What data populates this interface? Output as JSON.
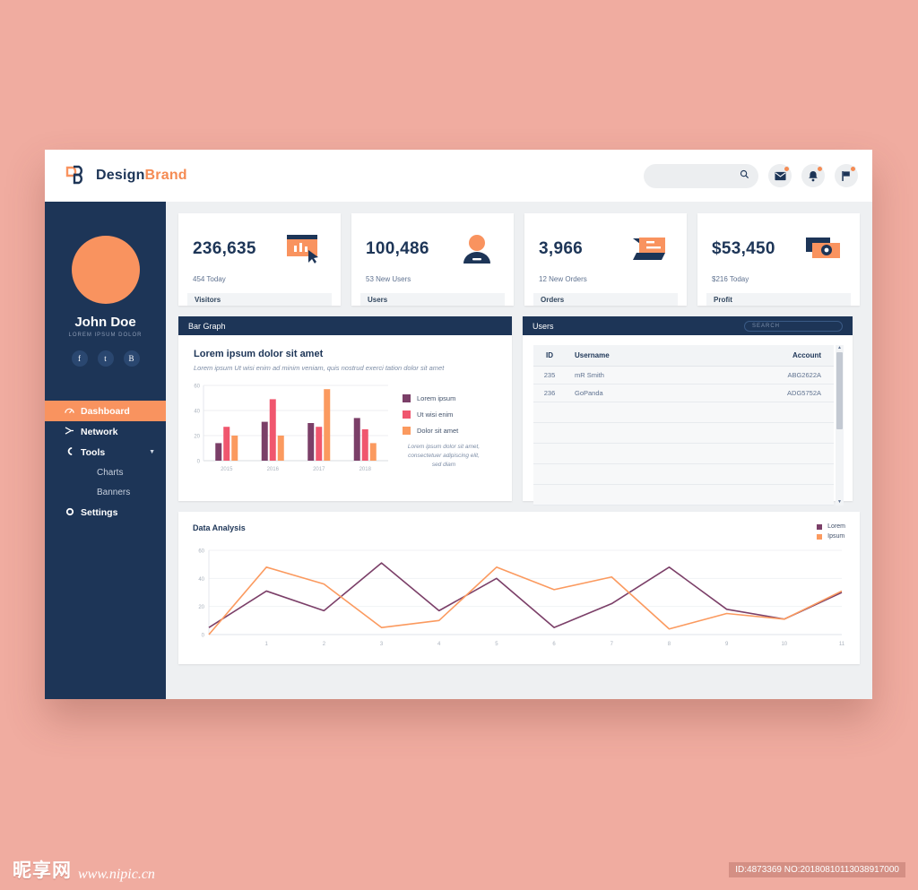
{
  "header": {
    "brand_first": "Design",
    "brand_second": "Brand",
    "search_placeholder": "",
    "search_value": "",
    "icons": [
      "search-icon",
      "mail-icon",
      "bell-icon",
      "flag-icon"
    ]
  },
  "sidebar": {
    "profile": {
      "name": "John Doe",
      "subtitle": "LOREM IPSUM DOLOR"
    },
    "socials": [
      {
        "name": "facebook",
        "label": "f"
      },
      {
        "name": "twitter",
        "label": "t"
      },
      {
        "name": "behance",
        "label": "B"
      }
    ],
    "items": [
      {
        "label": "Dashboard",
        "icon": "speedometer-icon",
        "active": true
      },
      {
        "label": "Network",
        "icon": "share-icon",
        "active": false
      },
      {
        "label": "Tools",
        "icon": "wrench-icon",
        "active": false,
        "expandable": true
      }
    ],
    "sub_items": [
      {
        "label": "Charts"
      },
      {
        "label": "Banners"
      }
    ],
    "settings": {
      "label": "Settings",
      "icon": "gear-icon"
    }
  },
  "stats": [
    {
      "value": "236,635",
      "sub": "454 Today",
      "footer": "Visitors",
      "icon": "browser-chart-icon"
    },
    {
      "value": "100,486",
      "sub": "53 New Users",
      "footer": "Users",
      "icon": "user-icon"
    },
    {
      "value": "3,966",
      "sub": "12 New Orders",
      "footer": "Orders",
      "icon": "chat-icon"
    },
    {
      "value": "$53,450",
      "sub": "$216 Today",
      "footer": "Profit",
      "icon": "card-icon"
    }
  ],
  "bar_panel": {
    "head": "Bar Graph",
    "title": "Lorem ipsum dolor sit amet",
    "description": "Lorem ipsum Ut wisi enim ad minim veniam, quis nostrud exerci tation dolor sit amet",
    "note": "Lorem ipsum dolor sit amet, consectetuer adipiscing elit, sed diam"
  },
  "users_panel": {
    "head": "Users",
    "search_placeholder": "SEARCH",
    "columns": [
      "ID",
      "Username",
      "Account"
    ],
    "rows": [
      {
        "id": "235",
        "username": "mR Smith",
        "account": "ABG2622A"
      },
      {
        "id": "236",
        "username": "GoPanda",
        "account": "ADG5752A"
      }
    ],
    "empty_row_count": 5
  },
  "analysis_panel": {
    "title": "Data Analysis"
  },
  "watermark": {
    "site_cn": "昵享网",
    "site_url": "www.nipic.cn",
    "id_text": "ID:4873369 NO:20180810113038917000"
  },
  "colors": {
    "navy": "#1d3557",
    "orange": "#f9935f",
    "purple": "#7b3f68",
    "pink": "#f0566e",
    "page_bg": "#f0aca0"
  },
  "chart_data": [
    {
      "type": "bar",
      "title": "Lorem ipsum dolor sit amet",
      "categories": [
        "2015",
        "2016",
        "2017",
        "2018"
      ],
      "series": [
        {
          "name": "Lorem ipsum",
          "color": "#7b3f68",
          "values": [
            14,
            31,
            30,
            34
          ]
        },
        {
          "name": "Ut wisi enim",
          "color": "#f0566e",
          "values": [
            27,
            49,
            27,
            25
          ]
        },
        {
          "name": "Dolor sit amet",
          "color": "#fb9a5f",
          "values": [
            20,
            20,
            57,
            14
          ]
        }
      ],
      "ylim": [
        0,
        60
      ],
      "yticks": [
        0,
        20,
        40,
        60
      ],
      "xlabel": "",
      "ylabel": "",
      "grid": true,
      "legend_position": "right"
    },
    {
      "type": "line",
      "title": "Data Analysis",
      "x": [
        0,
        1,
        2,
        3,
        4,
        5,
        6,
        7,
        8,
        9,
        10,
        11
      ],
      "xticks": [
        "1",
        "2",
        "3",
        "4",
        "5",
        "6",
        "7",
        "8",
        "9",
        "10",
        "11"
      ],
      "series": [
        {
          "name": "Lorem",
          "color": "#7b3f68",
          "values": [
            5,
            31,
            17,
            51,
            17,
            40,
            5,
            22,
            48,
            18,
            11,
            30
          ]
        },
        {
          "name": "Ipsum",
          "color": "#fb9a5f",
          "values": [
            0,
            48,
            36,
            5,
            10,
            48,
            32,
            41,
            4,
            15,
            11,
            31
          ]
        }
      ],
      "ylim": [
        0,
        60
      ],
      "yticks": [
        0,
        20,
        40,
        60
      ],
      "grid": true,
      "legend_position": "top-right"
    }
  ]
}
